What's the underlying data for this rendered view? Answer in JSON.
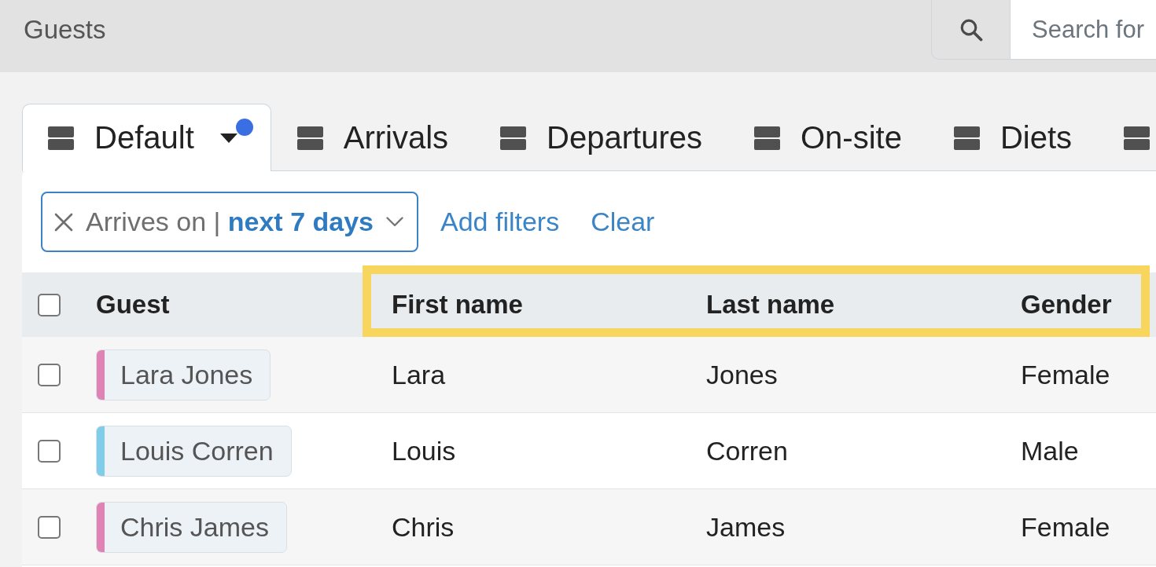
{
  "header": {
    "title": "Guests",
    "search": {
      "placeholder": "Search for"
    }
  },
  "tabs": [
    {
      "label": "Default",
      "selected": true,
      "dropdown": true,
      "notification": true
    },
    {
      "label": "Arrivals",
      "selected": false,
      "dropdown": false,
      "notification": false
    },
    {
      "label": "Departures",
      "selected": false,
      "dropdown": false,
      "notification": false
    },
    {
      "label": "On-site",
      "selected": false,
      "dropdown": false,
      "notification": false
    },
    {
      "label": "Diets",
      "selected": false,
      "dropdown": false,
      "notification": false
    },
    {
      "selected": false,
      "dropdown": false,
      "notification": false
    }
  ],
  "filters": {
    "chips": [
      {
        "label": "Arrives on | **next 7 days**"
      }
    ],
    "add_filters": "Add filters",
    "clear": "Clear"
  },
  "table": {
    "header_checked": false,
    "columns": [
      {
        "label": "Guest",
        "highlighted": false
      },
      {
        "label": "First name",
        "highlighted": true
      },
      {
        "label": "Last name",
        "highlighted": true
      },
      {
        "label": "Gender",
        "highlighted": true
      }
    ],
    "rows": [
      {
        "checked": false,
        "guest": "Lara Jones",
        "color": "#e182b4",
        "first_name": "Lara",
        "last_name": "Jones",
        "gender": "Female"
      },
      {
        "checked": false,
        "guest": "Louis Corren",
        "color": "#80cdea",
        "first_name": "Louis",
        "last_name": "Corren",
        "gender": "Male"
      },
      {
        "checked": false,
        "guest": "Chris James",
        "color": "#e182b4",
        "first_name": "Chris",
        "last_name": "James",
        "gender": "Female"
      }
    ]
  }
}
